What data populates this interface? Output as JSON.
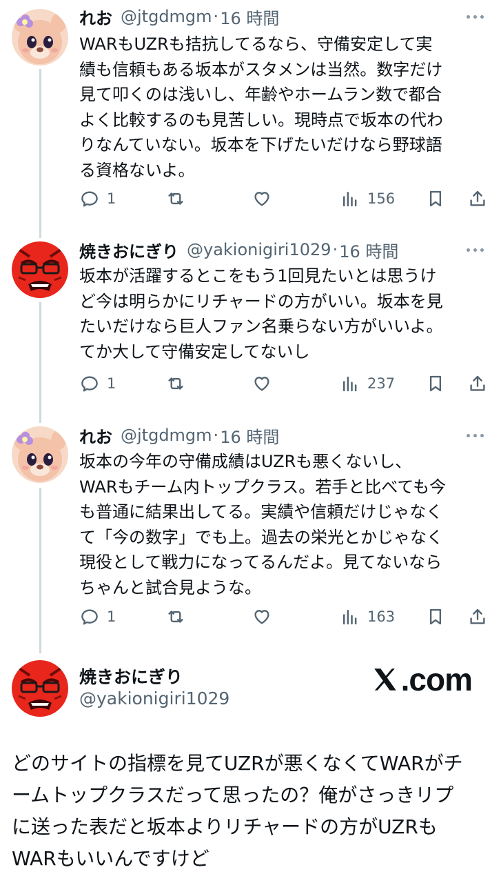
{
  "tweets": [
    {
      "name": "れお",
      "handle": "@jtgdmgm",
      "separator": "·",
      "time": "16 時間",
      "lines": [
        "WARもUZRも拮抗してるなら、守備安定して実",
        "績も信頼もある坂本がスタメンは当然。数字だけ",
        "見て叩くのは浅いし、年齢やホームラン数で都合",
        "よく比較するのも見苦しい。現時点で坂本の代わ",
        "りなんていない。坂本を下げたいだけなら野球語",
        "る資格ないよ。"
      ],
      "replies": "1",
      "retweets": "",
      "likes": "",
      "views": "156"
    },
    {
      "name": "焼きおにぎり",
      "handle": "@yakionigiri1029",
      "separator": "·",
      "time": "16 時間",
      "lines": [
        "坂本が活躍するとこをもう1回見たいとは思うけ",
        "ど今は明らかにリチャードの方がいい。坂本を見",
        "たいだけなら巨人ファン名乗らない方がいいよ。",
        "てか大して守備安定してないし"
      ],
      "replies": "1",
      "retweets": "",
      "likes": "",
      "views": "237"
    },
    {
      "name": "れお",
      "handle": "@jtgdmgm",
      "separator": "·",
      "time": "16 時間",
      "lines": [
        "坂本の今年の守備成績はUZRも悪くないし、",
        "WARもチーム内トップクラス。若手と比べても今",
        "も普通に結果出してる。実績や信頼だけじゃなく",
        "て「今の数字」でも上。過去の栄光とかじゃなく",
        "現役として戦力になってるんだよ。見てないなら",
        "ちゃんと試合見ような。"
      ],
      "replies": "1",
      "retweets": "",
      "likes": "",
      "views": "163"
    }
  ],
  "quote": {
    "name": "焼きおにぎり",
    "handle": "@yakionigiri1029",
    "brand": ".com",
    "lines": [
      "どのサイトの指標を見てUZRが悪くなくてWARがチ",
      "ームトップクラスだって思ったの？俺がさっきリプ",
      "に送った表だと坂本よりリチャードの方がUZRも",
      "WARもいいんですけど"
    ]
  },
  "colors": {
    "text": "#0f1419",
    "secondary": "#536471",
    "thread_line": "#cfd9de",
    "avatar_red": "#e8261c",
    "avatar_pink": "#f3c2a8"
  },
  "icons": [
    "reply-icon",
    "retweet-icon",
    "like-icon",
    "views-icon",
    "bookmark-icon",
    "share-icon",
    "more-icon",
    "x-logo-icon"
  ]
}
